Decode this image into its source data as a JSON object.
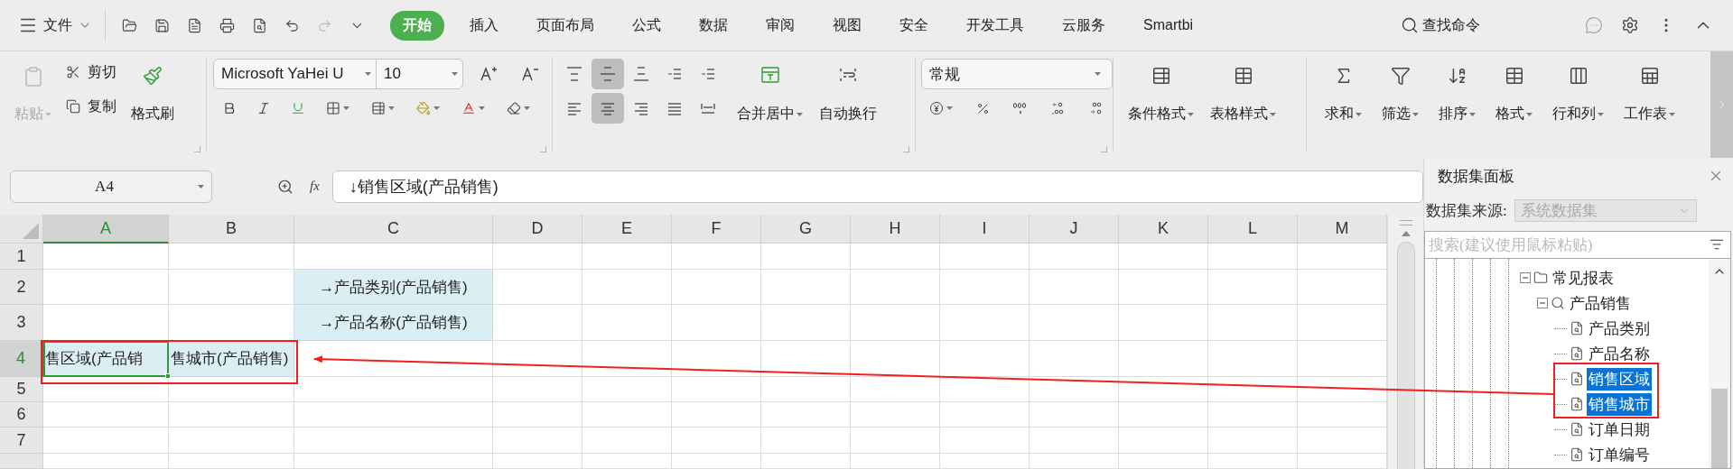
{
  "menu_bar": {
    "file_menu": "文件",
    "quick_tools": [
      {
        "kind": "open",
        "disabled": false
      },
      {
        "kind": "save",
        "disabled": false
      },
      {
        "kind": "pdf",
        "disabled": false
      },
      {
        "kind": "print",
        "disabled": false
      },
      {
        "kind": "preview",
        "disabled": false
      },
      {
        "kind": "undo",
        "disabled": false
      },
      {
        "kind": "redo",
        "disabled": true
      },
      {
        "kind": "more",
        "disabled": false
      }
    ],
    "tabs": [
      {
        "label": "开始",
        "selected": true
      },
      {
        "label": "插入",
        "selected": false
      },
      {
        "label": "页面布局",
        "selected": false
      },
      {
        "label": "公式",
        "selected": false
      },
      {
        "label": "数据",
        "selected": false
      },
      {
        "label": "审阅",
        "selected": false
      },
      {
        "label": "视图",
        "selected": false
      },
      {
        "label": "安全",
        "selected": false
      },
      {
        "label": "开发工具",
        "selected": false
      },
      {
        "label": "云服务",
        "selected": false
      },
      {
        "label": "Smartbi",
        "selected": false
      }
    ],
    "search": "查找命令"
  },
  "ribbon": {
    "clipboard": {
      "paste": {
        "label": "粘贴",
        "disabled": true
      },
      "cut": "剪切",
      "copy": "复制",
      "format_painter": "格式刷"
    },
    "font": {
      "family": "Microsoft YaHei U",
      "size": "10"
    },
    "alignment": {
      "vertical": [
        {
          "kind": "top",
          "selected": false
        },
        {
          "kind": "middle",
          "selected": true
        },
        {
          "kind": "bottom",
          "selected": false
        },
        {
          "kind": "outdent",
          "selected": false
        },
        {
          "kind": "indent",
          "selected": false
        }
      ],
      "horizontal": [
        {
          "kind": "left",
          "selected": false
        },
        {
          "kind": "center",
          "selected": true
        },
        {
          "kind": "right",
          "selected": false
        },
        {
          "kind": "justify",
          "selected": false
        },
        {
          "kind": "distributed",
          "selected": false
        }
      ],
      "merge": "合并居中",
      "wrap": "自动换行"
    },
    "number": {
      "format": "常规"
    },
    "styles": [
      {
        "kind": "conditional",
        "label": "条件格式"
      },
      {
        "kind": "table",
        "label": "表格样式"
      }
    ],
    "editing": [
      {
        "kind": "sum",
        "label": "求和"
      },
      {
        "kind": "filter",
        "label": "筛选"
      },
      {
        "kind": "sort",
        "label": "排序"
      },
      {
        "kind": "format",
        "label": "格式"
      },
      {
        "kind": "rows_cols",
        "label": "行和列"
      },
      {
        "kind": "sheet",
        "label": "工作表"
      }
    ]
  },
  "formula_bar": {
    "name_box": "A4",
    "fx": "fx",
    "value": "↓销售区域(产品销售)"
  },
  "sheet": {
    "columns": [
      {
        "label": "A",
        "selected": true
      },
      {
        "label": "B",
        "selected": false
      },
      {
        "label": "C",
        "selected": false
      },
      {
        "label": "D",
        "selected": false
      },
      {
        "label": "E",
        "selected": false
      },
      {
        "label": "F",
        "selected": false
      },
      {
        "label": "G",
        "selected": false
      },
      {
        "label": "H",
        "selected": false
      },
      {
        "label": "I",
        "selected": false
      },
      {
        "label": "J",
        "selected": false
      },
      {
        "label": "K",
        "selected": false
      },
      {
        "label": "L",
        "selected": false
      },
      {
        "label": "M",
        "selected": false
      }
    ],
    "rows": [
      {
        "label": "1",
        "selected": false,
        "cells": []
      },
      {
        "label": "2",
        "selected": false,
        "cells": [
          {
            "kind": "blank"
          },
          {
            "kind": "blank"
          },
          {
            "kind": "field",
            "text": "→产品类别(产品销售)",
            "selected": false
          }
        ]
      },
      {
        "label": "3",
        "selected": false,
        "cells": [
          {
            "kind": "blank"
          },
          {
            "kind": "blank"
          },
          {
            "kind": "field",
            "text": "→产品名称(产品销售)",
            "selected": false
          }
        ]
      },
      {
        "label": "4",
        "selected": true,
        "cells": [
          {
            "kind": "field",
            "text": "售区域(产品销",
            "selected": true
          },
          {
            "kind": "field",
            "text": "售城市(产品销售)",
            "selected": false
          }
        ]
      },
      {
        "label": "5",
        "selected": false,
        "cells": []
      },
      {
        "label": "6",
        "selected": false,
        "cells": []
      },
      {
        "label": "7",
        "selected": false,
        "cells": []
      }
    ]
  },
  "panel": {
    "title": "数据集面板",
    "source_label": "数据集来源:",
    "source": "系统数据集",
    "source_disabled": true,
    "search_placeholder": "搜索(建议使用鼠标粘贴)",
    "tree": [
      {
        "kind": "folder",
        "label": "常见报表",
        "expanded": true,
        "selected": false,
        "children": [
          {
            "kind": "dataset",
            "label": "产品销售",
            "expanded": true,
            "selected": false,
            "children": [
              {
                "kind": "field",
                "label": "产品类别",
                "selected": false
              },
              {
                "kind": "field",
                "label": "产品名称",
                "selected": false
              },
              {
                "kind": "field",
                "label": "销售区域",
                "selected": true
              },
              {
                "kind": "field",
                "label": "销售城市",
                "selected": true
              },
              {
                "kind": "field",
                "label": "订单日期",
                "selected": false
              },
              {
                "kind": "field",
                "label": "订单编号",
                "selected": false
              }
            ]
          }
        ]
      }
    ]
  }
}
